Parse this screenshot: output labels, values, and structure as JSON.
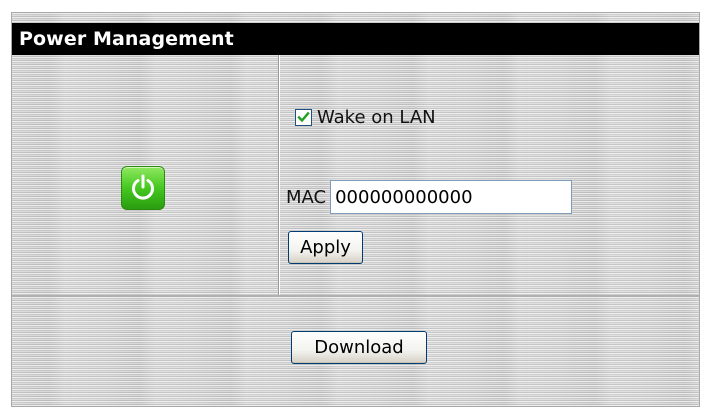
{
  "header": {
    "title": "Power Management"
  },
  "power": {
    "icon": "power-icon",
    "icon_color": "#45c81f"
  },
  "wake_on_lan": {
    "label": "Wake on LAN",
    "checked": true
  },
  "mac": {
    "label": "MAC",
    "value": "000000000000"
  },
  "buttons": {
    "apply": "Apply",
    "download": "Download"
  }
}
